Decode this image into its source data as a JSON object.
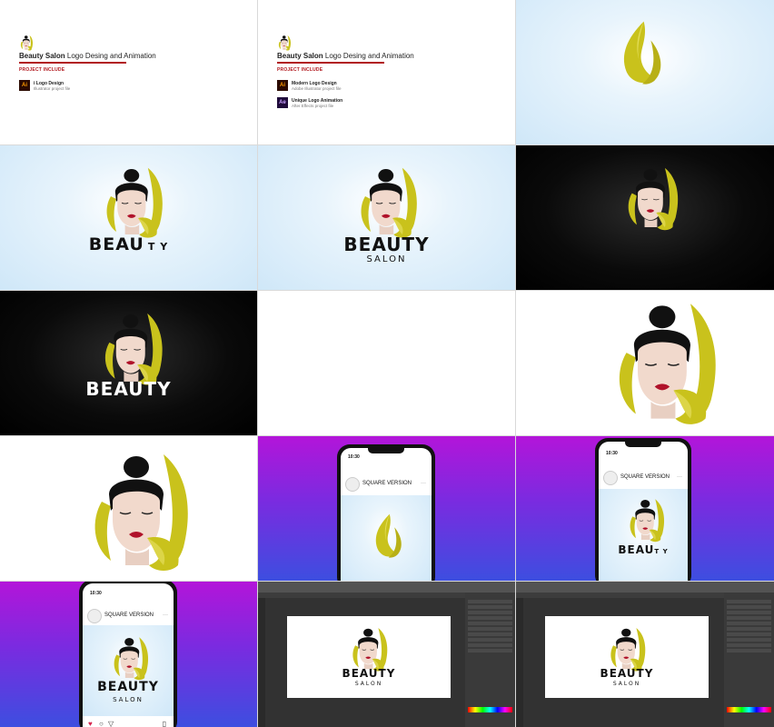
{
  "intro": {
    "title_bold": "Beauty Salon",
    "title_rest": " Logo Desing and Animation",
    "subtitle": "PROJECT INCLUDE",
    "slide1_item1_title": "i Logo Design",
    "slide1_item1_desc": "Illustrator project file",
    "item1_title": "Modern Logo Design",
    "item1_desc": "Adobe Illustrator project file",
    "item2_title": "Unique Logo Animation",
    "item2_desc": "After Effects project file",
    "ai_icon": "Ai",
    "ae_icon": "Ae"
  },
  "logo": {
    "word_partial": "BEAU",
    "word_partial_tail": "T  Y",
    "word": "BEAUTY",
    "salon": "SALON"
  },
  "phone": {
    "time": "10:30",
    "label": "SQUARE VERSION",
    "menu": "···"
  },
  "colors": {
    "accent_red": "#b1161c",
    "leaf_yellow": "#c9c21c",
    "skin": "#f1d9cc",
    "hair": "#111111",
    "lips": "#b0122a",
    "purple_top": "#b315d9",
    "blue_bottom": "#3d4ee0"
  }
}
